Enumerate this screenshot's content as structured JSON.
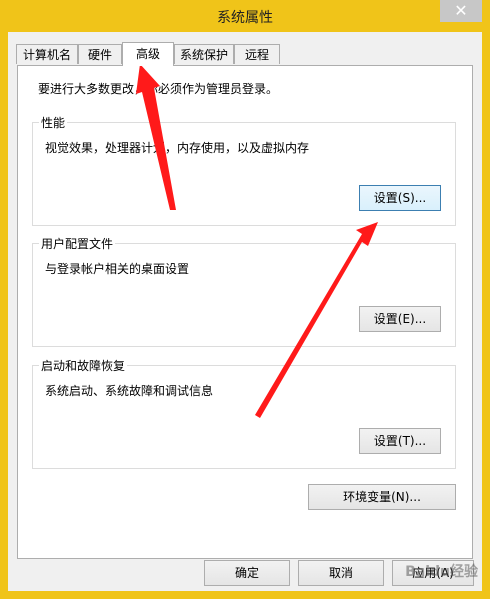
{
  "window": {
    "title": "系统属性",
    "close_glyph": "✕"
  },
  "tabs": [
    {
      "label": "计算机名"
    },
    {
      "label": "硬件"
    },
    {
      "label": "高级"
    },
    {
      "label": "系统保护"
    },
    {
      "label": "远程"
    }
  ],
  "panel": {
    "note": "要进行大多数更改，你必须作为管理员登录。",
    "performance": {
      "label": "性能",
      "desc": "视觉效果，处理器计划，内存使用，以及虚拟内存",
      "button": "设置(S)..."
    },
    "profiles": {
      "label": "用户配置文件",
      "desc": "与登录帐户相关的桌面设置",
      "button": "设置(E)..."
    },
    "startup": {
      "label": "启动和故障恢复",
      "desc": "系统启动、系统故障和调试信息",
      "button": "设置(T)..."
    },
    "env_button": "环境变量(N)..."
  },
  "footer": {
    "ok": "确定",
    "cancel": "取消",
    "apply": "应用(A)"
  },
  "watermark": "Baidu经验",
  "colors": {
    "frame": "#f0c419",
    "arrow": "#ff1a1a"
  }
}
